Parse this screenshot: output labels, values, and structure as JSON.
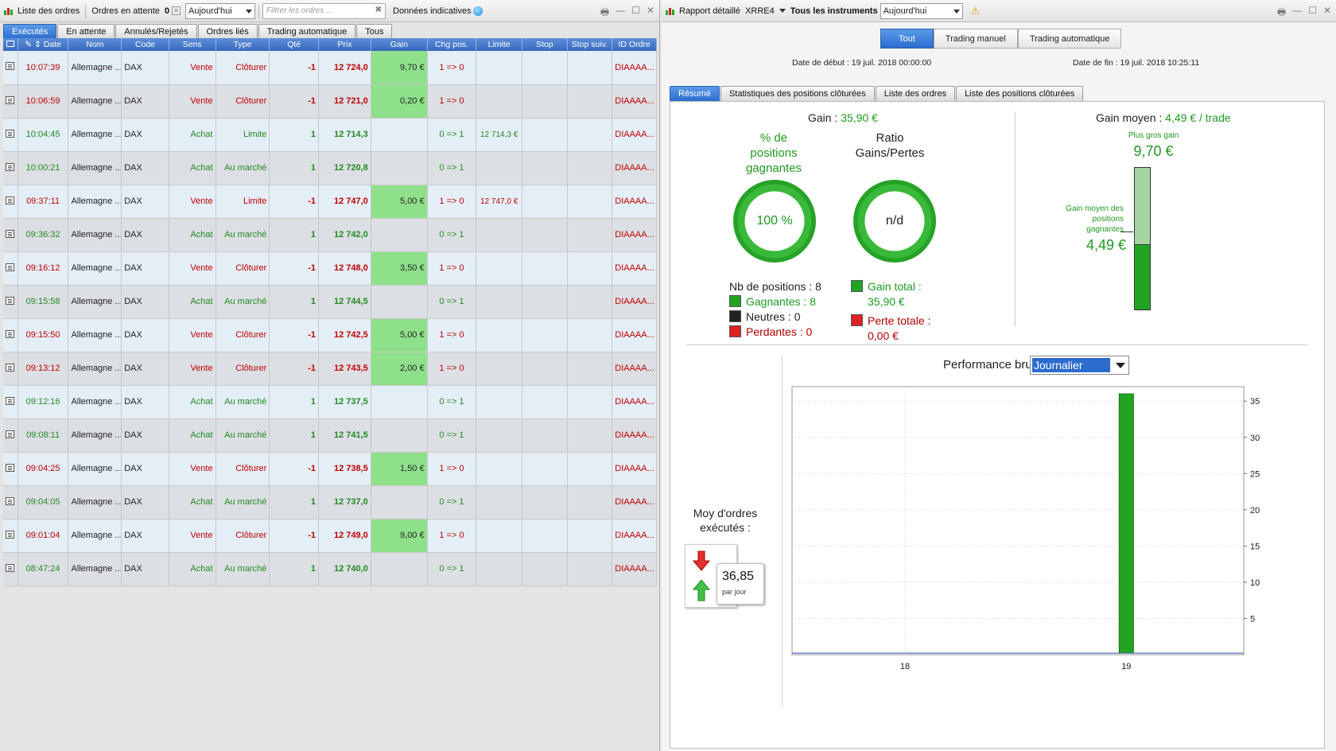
{
  "left": {
    "toolbar": {
      "title": "Liste des ordres",
      "pending_label": "Ordres en attente",
      "pending_count": "0",
      "period": "Aujourd'hui",
      "filter_placeholder": "Filtrer les ordres ...",
      "indicative": "Données indicatives"
    },
    "tabs": [
      "Exécutés",
      "En attente",
      "Annulés/Rejetés",
      "Ordres liés",
      "Trading automatique",
      "Tous"
    ],
    "columns": [
      "Date",
      "Nom",
      "Code",
      "Sens",
      "Type",
      "Qté",
      "Prix",
      "Gain",
      "Chg pos.",
      "Limite",
      "Stop",
      "Stop suiv.",
      "ID Ordre"
    ],
    "rows": [
      {
        "date": "10:07:39",
        "nom": "Allemagne ...",
        "code": "DAX",
        "sens": "Vente",
        "type": "Clôturer",
        "qte": "-1",
        "prix": "12 724,0",
        "gain": "9,70 €",
        "chg": "1 => 0",
        "limite": "",
        "id": "DIAAAA..."
      },
      {
        "date": "10:06:59",
        "nom": "Allemagne ...",
        "code": "DAX",
        "sens": "Vente",
        "type": "Clôturer",
        "qte": "-1",
        "prix": "12 721,0",
        "gain": "0,20 €",
        "chg": "1 => 0",
        "limite": "",
        "id": "DIAAAA..."
      },
      {
        "date": "10:04:45",
        "nom": "Allemagne ...",
        "code": "DAX",
        "sens": "Achat",
        "type": "Limite",
        "qte": "1",
        "prix": "12 714,3",
        "gain": "",
        "chg": "0 => 1",
        "limite": "12 714,3 €",
        "id": "DIAAAA..."
      },
      {
        "date": "10:00:21",
        "nom": "Allemagne ...",
        "code": "DAX",
        "sens": "Achat",
        "type": "Au marché",
        "qte": "1",
        "prix": "12 720,8",
        "gain": "",
        "chg": "0 => 1",
        "limite": "",
        "id": "DIAAAA..."
      },
      {
        "date": "09:37:11",
        "nom": "Allemagne ...",
        "code": "DAX",
        "sens": "Vente",
        "type": "Limite",
        "qte": "-1",
        "prix": "12 747,0",
        "gain": "5,00 €",
        "chg": "1 => 0",
        "limite": "12 747,0 €",
        "id": "DIAAAA..."
      },
      {
        "date": "09:36:32",
        "nom": "Allemagne ...",
        "code": "DAX",
        "sens": "Achat",
        "type": "Au marché",
        "qte": "1",
        "prix": "12 742,0",
        "gain": "",
        "chg": "0 => 1",
        "limite": "",
        "id": "DIAAAA..."
      },
      {
        "date": "09:16:12",
        "nom": "Allemagne ...",
        "code": "DAX",
        "sens": "Vente",
        "type": "Clôturer",
        "qte": "-1",
        "prix": "12 748,0",
        "gain": "3,50 €",
        "chg": "1 => 0",
        "limite": "",
        "id": "DIAAAA..."
      },
      {
        "date": "09:15:58",
        "nom": "Allemagne ...",
        "code": "DAX",
        "sens": "Achat",
        "type": "Au marché",
        "qte": "1",
        "prix": "12 744,5",
        "gain": "",
        "chg": "0 => 1",
        "limite": "",
        "id": "DIAAAA..."
      },
      {
        "date": "09:15:50",
        "nom": "Allemagne ...",
        "code": "DAX",
        "sens": "Vente",
        "type": "Clôturer",
        "qte": "-1",
        "prix": "12 742,5",
        "gain": "5,00 €",
        "chg": "1 => 0",
        "limite": "",
        "id": "DIAAAA..."
      },
      {
        "date": "09:13:12",
        "nom": "Allemagne ...",
        "code": "DAX",
        "sens": "Vente",
        "type": "Clôturer",
        "qte": "-1",
        "prix": "12 743,5",
        "gain": "2,00 €",
        "chg": "1 => 0",
        "limite": "",
        "id": "DIAAAA..."
      },
      {
        "date": "09:12:16",
        "nom": "Allemagne ...",
        "code": "DAX",
        "sens": "Achat",
        "type": "Au marché",
        "qte": "1",
        "prix": "12 737,5",
        "gain": "",
        "chg": "0 => 1",
        "limite": "",
        "id": "DIAAAA..."
      },
      {
        "date": "09:08:11",
        "nom": "Allemagne ...",
        "code": "DAX",
        "sens": "Achat",
        "type": "Au marché",
        "qte": "1",
        "prix": "12 741,5",
        "gain": "",
        "chg": "0 => 1",
        "limite": "",
        "id": "DIAAAA..."
      },
      {
        "date": "09:04:25",
        "nom": "Allemagne ...",
        "code": "DAX",
        "sens": "Vente",
        "type": "Clôturer",
        "qte": "-1",
        "prix": "12 738,5",
        "gain": "1,50 €",
        "chg": "1 => 0",
        "limite": "",
        "id": "DIAAAA..."
      },
      {
        "date": "09:04:05",
        "nom": "Allemagne ...",
        "code": "DAX",
        "sens": "Achat",
        "type": "Au marché",
        "qte": "1",
        "prix": "12 737,0",
        "gain": "",
        "chg": "0 => 1",
        "limite": "",
        "id": "DIAAAA..."
      },
      {
        "date": "09:01:04",
        "nom": "Allemagne ...",
        "code": "DAX",
        "sens": "Vente",
        "type": "Clôturer",
        "qte": "-1",
        "prix": "12 749,0",
        "gain": "9,00 €",
        "chg": "1 => 0",
        "limite": "",
        "id": "DIAAAA..."
      },
      {
        "date": "08:47:24",
        "nom": "Allemagne ...",
        "code": "DAX",
        "sens": "Achat",
        "type": "Au marché",
        "qte": "1",
        "prix": "12 740,0",
        "gain": "",
        "chg": "0 => 1",
        "limite": "",
        "id": "DIAAAA..."
      }
    ]
  },
  "right": {
    "toolbar": {
      "title": "Rapport détaillé",
      "account": "XRRE4",
      "instruments": "Tous les instruments",
      "period": "Aujourd'hui"
    },
    "segments": [
      "Tout",
      "Trading manuel",
      "Trading automatique"
    ],
    "date_start_label": "Date de début :",
    "date_start": "19 juil. 2018 00:00:00",
    "date_end_label": "Date de fin :",
    "date_end": "19 juil. 2018 10:25:11",
    "tabs": [
      "Résumé",
      "Statistiques des positions clôturées",
      "Liste des ordres",
      "Liste des positions clôturées"
    ],
    "summary": {
      "gain_label": "Gain :",
      "gain": "35,90 €",
      "pct_label_1": "% de",
      "pct_label_2": "positions",
      "pct_label_3": "gagnantes",
      "pct_value": "100 %",
      "pct_fraction": 1.0,
      "ratio_label_1": "Ratio",
      "ratio_label_2": "Gains/Pertes",
      "ratio_value": "n/d",
      "nb_positions": "Nb de positions : 8",
      "winning": "Gagnantes : 8",
      "neutral": "Neutres : 0",
      "losing": "Perdantes : 0",
      "total_gain_label": "Gain total :",
      "total_gain": "35,90 €",
      "total_loss_label": "Perte totale :",
      "total_loss": "0,00 €",
      "avg_gain_label": "Gain moyen :",
      "avg_gain": "4,49 € / trade",
      "biggest_label": "Plus gros gain",
      "biggest": "9,70 €",
      "avg_win_label_1": "Gain moyen des",
      "avg_win_label_2": "positions",
      "avg_win_label_3": "gagnantes",
      "avg_win": "4,49 €",
      "avg_win_fraction": 0.463
    },
    "performance": {
      "label": "Performance brute",
      "period": "Journalier"
    },
    "orders_avg": {
      "label_1": "Moy d'ordres",
      "label_2": "exécutés :",
      "value": "36,85",
      "unit": "par jour"
    }
  },
  "chart_data": {
    "type": "bar",
    "categories": [
      "18",
      "19"
    ],
    "values": [
      0,
      36
    ],
    "ylim": [
      0,
      37
    ],
    "yticks": [
      "5",
      "10",
      "15",
      "20",
      "25",
      "30",
      "35"
    ],
    "grid": true,
    "color": "#22a422"
  }
}
